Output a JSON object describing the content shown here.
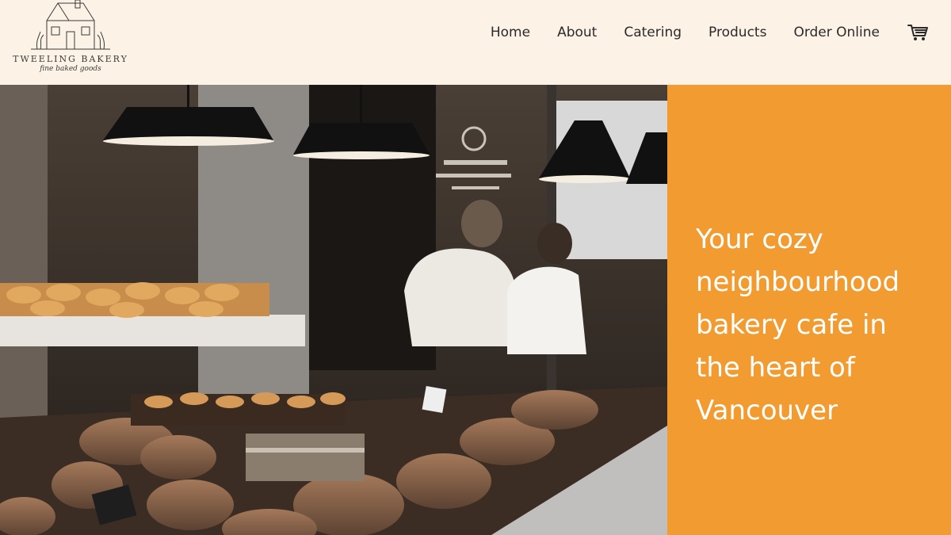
{
  "brand": {
    "name": "TWEELING BAKERY",
    "tagline": "fine baked goods"
  },
  "nav": {
    "items": [
      {
        "label": "Home"
      },
      {
        "label": "About"
      },
      {
        "label": "Catering"
      },
      {
        "label": "Products"
      },
      {
        "label": "Order Online"
      }
    ],
    "cart_icon": "cart-icon"
  },
  "hero": {
    "headline": "Your cozy neighbourhood bakery cafe in the heart of Vancouver",
    "panel_color": "#f29b31",
    "image_subject": "bakery-interior-photo"
  },
  "colors": {
    "header_bg": "#fcf3e6",
    "accent": "#f29b31",
    "text": "#2a2a2a"
  }
}
